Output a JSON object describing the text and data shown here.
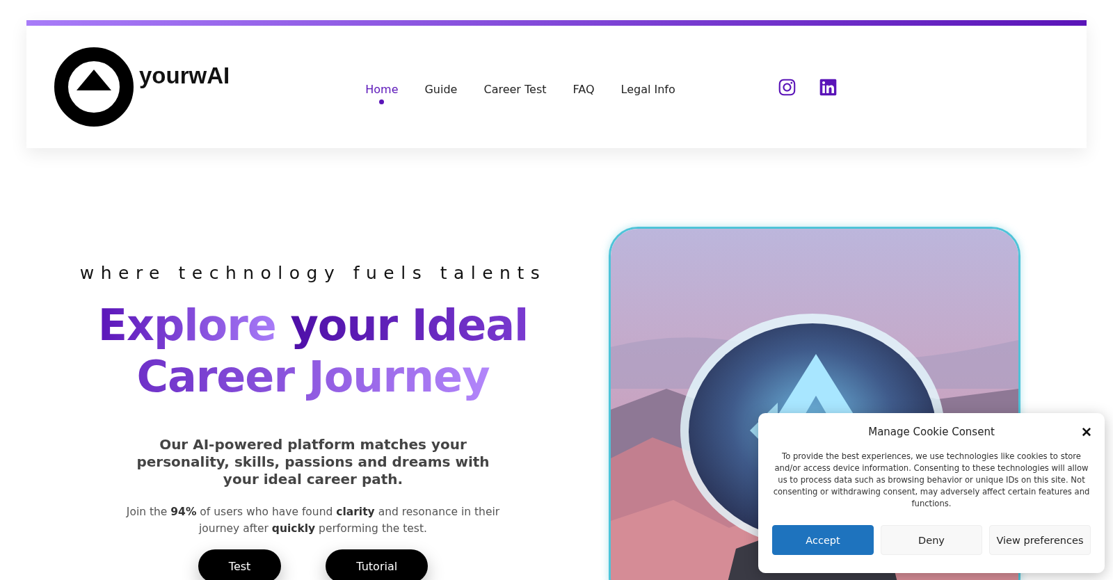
{
  "header": {
    "logo_text": "yourwAI",
    "nav": [
      {
        "label": "Home",
        "selected": true
      },
      {
        "label": "Guide",
        "selected": false
      },
      {
        "label": "Career Test",
        "selected": false
      },
      {
        "label": "FAQ",
        "selected": false
      },
      {
        "label": "Legal Info",
        "selected": false
      }
    ],
    "social": [
      {
        "kind": "instagram"
      },
      {
        "kind": "linkedin"
      }
    ]
  },
  "hero": {
    "tagline": "where technology fuels talents",
    "title_line1": [
      "Explore",
      "your Ideal"
    ],
    "title_line2": "Career Journey",
    "subtitle": "Our AI-powered platform matches your personality, skills, passions and dreams with your ideal career path.",
    "text": "Join the **94%** of users who have found **clarity** and resonance in their journey after **quickly** performing the test.",
    "buttons": [
      "Test",
      "Tutorial"
    ],
    "image": {
      "kind": "picture"
    }
  },
  "cookie_dialog": {
    "title": "Manage Cookie Consent",
    "close": "✕",
    "text": "To provide the best experiences, we use technologies like cookies to store and/or access device information. Consenting to these technologies will allow us to process data such as browsing behavior or unique IDs on this site. Not consenting or withdrawing consent, may adversely affect certain features and functions.",
    "buttons": [
      {
        "label": "Accept",
        "kind": "primary"
      },
      {
        "label": "Deny",
        "kind": "secondary"
      },
      {
        "label": "View preferences",
        "kind": "secondary"
      }
    ]
  }
}
